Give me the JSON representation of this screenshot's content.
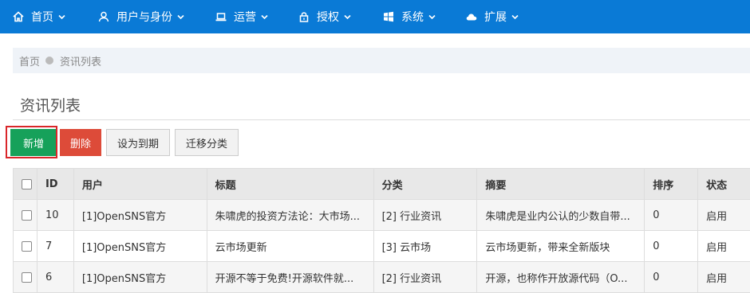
{
  "nav": {
    "items": [
      {
        "label": "首页",
        "icon": "home-icon"
      },
      {
        "label": "用户与身份",
        "icon": "user-icon"
      },
      {
        "label": "运营",
        "icon": "laptop-icon"
      },
      {
        "label": "授权",
        "icon": "lock-icon"
      },
      {
        "label": "系统",
        "icon": "windows-icon"
      },
      {
        "label": "扩展",
        "icon": "cloud-icon"
      }
    ],
    "bar_color": "#0a7ad6"
  },
  "breadcrumb": {
    "home": "首页",
    "current": "资讯列表"
  },
  "page": {
    "title": "资讯列表"
  },
  "toolbar": {
    "add_label": "新增",
    "delete_label": "删除",
    "expire_label": "设为到期",
    "move_label": "迁移分类",
    "add_color": "#16a15a",
    "delete_color": "#dd4b39",
    "highlight_color": "#d9262a"
  },
  "table": {
    "headers": [
      "ID",
      "用户",
      "标题",
      "分类",
      "摘要",
      "排序",
      "状态"
    ],
    "rows": [
      {
        "id": "10",
        "user": "[1]OpenSNS官方",
        "title": "朱啸虎的投资方法论：大市场...",
        "category": "[2] 行业资讯",
        "summary": "朱啸虎是业内公认的少数自带...",
        "order": "0",
        "status": "启用"
      },
      {
        "id": "7",
        "user": "[1]OpenSNS官方",
        "title": "云市场更新",
        "category": "[3] 云市场",
        "summary": "云市场更新，带来全新版块",
        "order": "0",
        "status": "启用"
      },
      {
        "id": "6",
        "user": "[1]OpenSNS官方",
        "title": "开源不等于免费!开源软件就...",
        "category": "[2] 行业资讯",
        "summary": "开源，也称作开放源代码（O...",
        "order": "0",
        "status": "启用"
      }
    ]
  }
}
